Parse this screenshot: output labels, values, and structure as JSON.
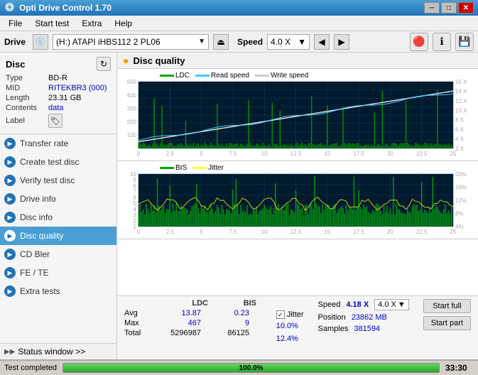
{
  "titleBar": {
    "title": "Opti Drive Control 1.70",
    "icon": "💿",
    "minimize": "─",
    "maximize": "□",
    "close": "✕"
  },
  "menuBar": {
    "items": [
      "File",
      "Start test",
      "Extra",
      "Help"
    ]
  },
  "driveBar": {
    "label": "Drive",
    "driveValue": "(H:)  ATAPI iHBS112  2 PL06",
    "speedLabel": "Speed",
    "speedValue": "4.0 X"
  },
  "disc": {
    "title": "Disc",
    "refreshIcon": "↻",
    "fields": [
      {
        "key": "Type",
        "value": "BD-R",
        "isBlue": false
      },
      {
        "key": "MID",
        "value": "RITEKBR3 (000)",
        "isBlue": true
      },
      {
        "key": "Length",
        "value": "23.31 GB",
        "isBlue": false
      },
      {
        "key": "Contents",
        "value": "data",
        "isBlue": true
      },
      {
        "key": "Label",
        "value": "",
        "isBlue": false
      }
    ]
  },
  "sidebar": {
    "navItems": [
      {
        "id": "transfer-rate",
        "label": "Transfer rate",
        "iconColor": "blue"
      },
      {
        "id": "create-test-disc",
        "label": "Create test disc",
        "iconColor": "blue"
      },
      {
        "id": "verify-test-disc",
        "label": "Verify test disc",
        "iconColor": "blue"
      },
      {
        "id": "drive-info",
        "label": "Drive info",
        "iconColor": "blue"
      },
      {
        "id": "disc-info",
        "label": "Disc info",
        "iconColor": "blue"
      },
      {
        "id": "disc-quality",
        "label": "Disc quality",
        "iconColor": "green",
        "active": true
      },
      {
        "id": "cd-bler",
        "label": "CD Bler",
        "iconColor": "blue"
      },
      {
        "id": "fe-te",
        "label": "FE / TE",
        "iconColor": "blue"
      },
      {
        "id": "extra-tests",
        "label": "Extra tests",
        "iconColor": "blue"
      }
    ],
    "statusWindow": "Status window >>",
    "testCompleted": "Test completed"
  },
  "chartPanel": {
    "title": "Disc quality",
    "iconColor": "#ff9900",
    "topChart": {
      "legend": [
        {
          "label": "LDC",
          "color": "#00aa00"
        },
        {
          "label": "Read speed",
          "color": "#44ccff"
        },
        {
          "label": "Write speed",
          "color": "#ffffff"
        }
      ],
      "yMax": 500,
      "yMin": 0,
      "xMax": 25.0,
      "yRight": [
        "16 X",
        "14 X",
        "12 X",
        "10 X",
        "8 X",
        "6 X",
        "4 X",
        "2 X"
      ]
    },
    "bottomChart": {
      "legend": [
        {
          "label": "BIS",
          "color": "#00aa00"
        },
        {
          "label": "Jitter",
          "color": "#ffff44"
        }
      ],
      "yMax": 10,
      "yMin": 1,
      "xMax": 25.0,
      "yRight": [
        "20%",
        "16%",
        "12%",
        "8%",
        "4%"
      ]
    }
  },
  "stats": {
    "headers": [
      "LDC",
      "BIS"
    ],
    "avg": {
      "ldc": "13.87",
      "bis": "0.23"
    },
    "max": {
      "ldc": "467",
      "bis": "9"
    },
    "total": {
      "ldc": "5296987",
      "bis": "86125"
    },
    "jitterEnabled": true,
    "jitter": {
      "avg": "10.0%",
      "max": "12.4%",
      "label": "Jitter"
    },
    "speed": {
      "label": "Speed",
      "value": "4.18 X",
      "dropdownValue": "4.0 X"
    },
    "position": {
      "label": "Position",
      "value": "23862 MB"
    },
    "samples": {
      "label": "Samples",
      "value": "381594"
    },
    "buttons": {
      "startFull": "Start full",
      "startPart": "Start part"
    }
  },
  "bottomBar": {
    "progressPercent": 100,
    "progressLabel": "100.0%",
    "time": "33:30",
    "testCompleted": "Test completed"
  }
}
